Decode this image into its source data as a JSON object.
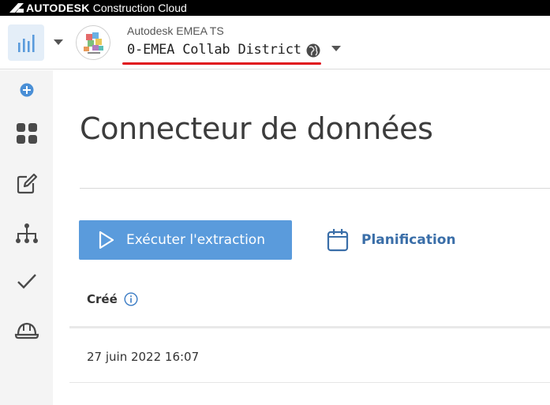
{
  "topbar": {
    "brand": "AUTODESK",
    "product": "Construction Cloud"
  },
  "header": {
    "account_name": "Autodesk EMEA TS",
    "project_name": "0-EMEA Collab District",
    "app_icon": "bar-chart-icon",
    "project_icon": "globe-icon"
  },
  "sidebar": {
    "items": [
      {
        "icon": "add-circle-icon"
      },
      {
        "icon": "grid-apps-icon"
      },
      {
        "icon": "edit-icon"
      },
      {
        "icon": "hierarchy-icon"
      },
      {
        "icon": "checkmark-icon"
      },
      {
        "icon": "hard-hat-icon"
      }
    ]
  },
  "main": {
    "title": "Connecteur de données",
    "run_button": "Exécuter l'extraction",
    "schedule_button": "Planification",
    "table": {
      "columns": [
        "Créé"
      ],
      "rows": [
        [
          "27 juin 2022 16:07"
        ]
      ]
    }
  },
  "colors": {
    "accent": "#5a9bdc",
    "link": "#3a6ea8",
    "highlight": "#e0101a",
    "topbar": "#000000",
    "sidebar": "#f4f4f4"
  }
}
